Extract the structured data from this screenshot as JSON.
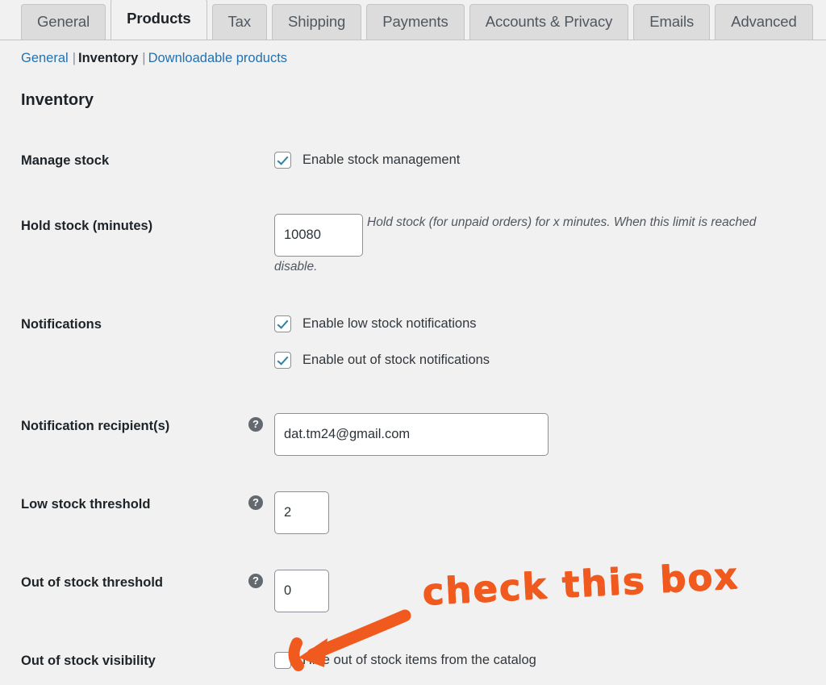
{
  "tabs": [
    {
      "label": "General",
      "active": false
    },
    {
      "label": "Products",
      "active": true
    },
    {
      "label": "Tax",
      "active": false
    },
    {
      "label": "Shipping",
      "active": false
    },
    {
      "label": "Payments",
      "active": false
    },
    {
      "label": "Accounts & Privacy",
      "active": false
    },
    {
      "label": "Emails",
      "active": false
    },
    {
      "label": "Advanced",
      "active": false
    }
  ],
  "subnav": {
    "general": "General",
    "inventory": "Inventory",
    "downloadable": "Downloadable products",
    "separator": "|"
  },
  "section": {
    "title": "Inventory"
  },
  "rows": {
    "manage_stock": {
      "label": "Manage stock",
      "checkbox_label": "Enable stock management",
      "checked": true
    },
    "hold_stock": {
      "label": "Hold stock (minutes)",
      "value": "10080",
      "description": "Hold stock (for unpaid orders) for x minutes. When this limit is reached",
      "description_line2": "disable."
    },
    "notifications": {
      "label": "Notifications",
      "low_stock_label": "Enable low stock notifications",
      "low_stock_checked": true,
      "out_of_stock_label": "Enable out of stock notifications",
      "out_of_stock_checked": true
    },
    "notification_recipients": {
      "label": "Notification recipient(s)",
      "value": "dat.tm24@gmail.com",
      "help_icon": "help-icon",
      "help_glyph": "?"
    },
    "low_stock_threshold": {
      "label": "Low stock threshold",
      "value": "2",
      "help_glyph": "?"
    },
    "out_of_stock_threshold": {
      "label": "Out of stock threshold",
      "value": "0",
      "help_glyph": "?"
    },
    "out_of_stock_visibility": {
      "label": "Out of stock visibility",
      "checkbox_label": "Hide out of stock items from the catalog",
      "checked": false
    }
  },
  "annotation": {
    "text": "check this box",
    "color": "#f05a1e",
    "arrow_name": "annotation-arrow"
  },
  "colors": {
    "background": "#f1f1f1",
    "link": "#2271b1",
    "text": "#1d2327",
    "checkmark": "#2e81a1",
    "annotation": "#f05a1e"
  }
}
